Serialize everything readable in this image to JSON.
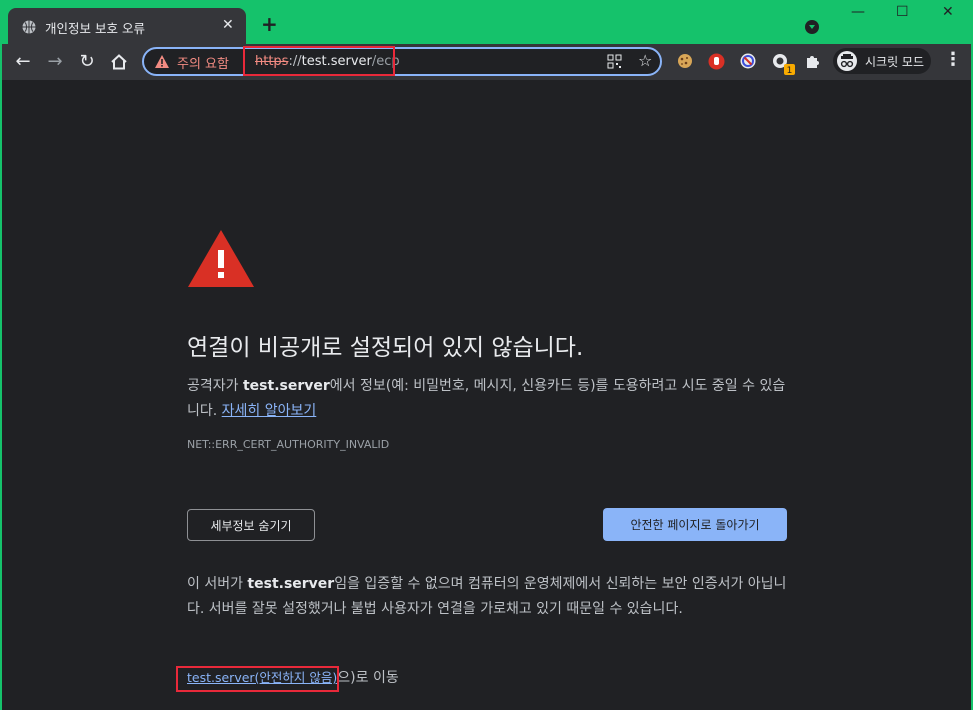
{
  "browser": {
    "tab_title": "개인정보 보호 오류",
    "new_tab_symbol": "+",
    "window_controls": [
      "—",
      "☐",
      "✕"
    ],
    "security_chip_label": "주의 요함",
    "url": {
      "scheme": "https",
      "separator": "://",
      "host": "test.server",
      "path": "/ecp"
    },
    "incognito_label": "시크릿 모드",
    "extension_badge": "1",
    "icons": [
      "back-icon",
      "forward-icon",
      "reload-icon",
      "home-icon",
      "warning-icon",
      "qr-icon",
      "star-icon",
      "cookie-icon",
      "stop-hand-icon",
      "block-icon",
      "extension-badge-icon",
      "puzzle-icon",
      "incognito-icon",
      "menu-icon"
    ]
  },
  "page": {
    "heading": "연결이 비공개로 설정되어 있지 않습니다.",
    "desc_part1": "공격자가 ",
    "desc_host": "test.server",
    "desc_part2": "에서 정보(예: 비밀번호, 메시지, 신용카드 등)를 도용하려고 시도 중일 수 있습니다. ",
    "learn_more": "자세히 알아보기",
    "error_code": "NET::ERR_CERT_AUTHORITY_INVALID",
    "hide_details_button": "세부정보 숨기기",
    "back_to_safety_button": "안전한 페이지로 돌아가기",
    "details_part1": "이 서버가 ",
    "details_host": "test.server",
    "details_part2": "임을 입증할 수 없으며 컴퓨터의 운영체제에서 신뢰하는 보안 인증서가 아닙니다. 서버를 잘못 설정했거나 불법 사용자가 연결을 가로채고 있기 때문일 수 있습니다.",
    "proceed_link": "test.server(안전하지 않음)",
    "proceed_suffix": "으)로 이동"
  },
  "colors": {
    "frame": "#15c26b",
    "toolbar": "#35363a",
    "page_bg": "#202124",
    "warning_red": "#d93025",
    "link_blue": "#8ab4f8",
    "highlight_box": "#e8293a"
  }
}
